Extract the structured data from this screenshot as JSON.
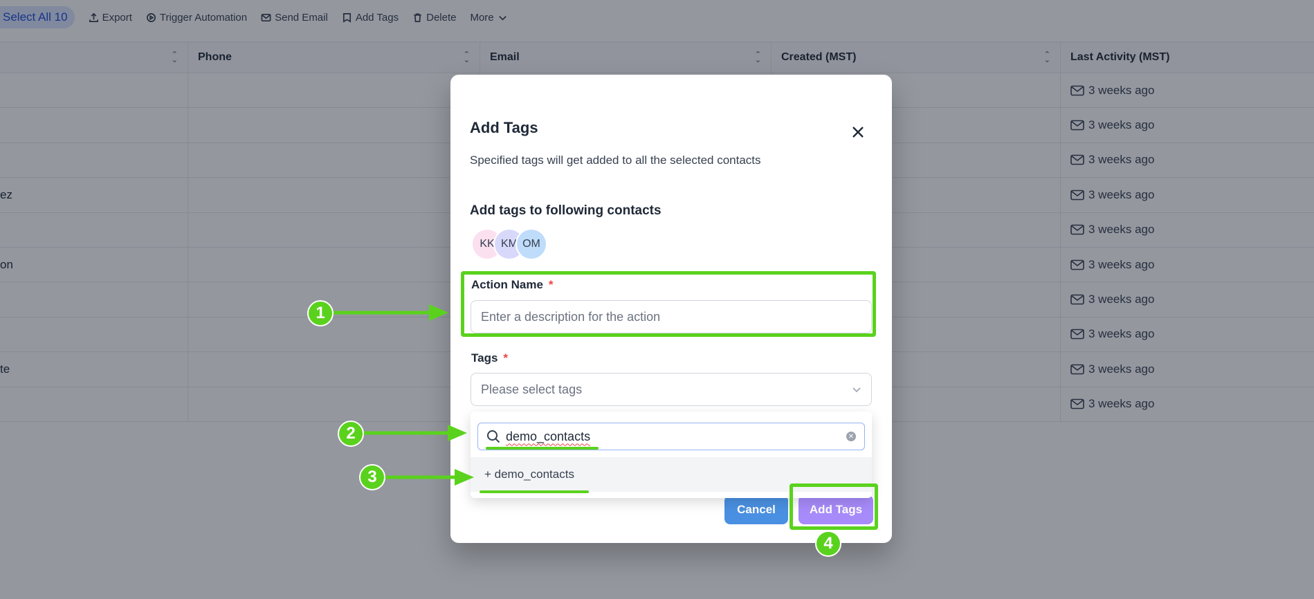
{
  "toolbar": {
    "select_all": "Select All 10",
    "items": [
      {
        "label": "Export",
        "icon": "upload-icon"
      },
      {
        "label": "Trigger Automation",
        "icon": "automation-icon"
      },
      {
        "label": "Send Email",
        "icon": "mail-icon"
      },
      {
        "label": "Add Tags",
        "icon": "tag-icon"
      },
      {
        "label": "Delete",
        "icon": "trash-icon"
      },
      {
        "label": "More",
        "icon": "chevron-down-icon"
      }
    ]
  },
  "table": {
    "headers": [
      "",
      "Phone",
      "Email",
      "Created (MST)",
      "Last Activity (MST)"
    ],
    "rows": [
      {
        "name_fragment": "",
        "last_activity": "3 weeks ago"
      },
      {
        "name_fragment": "",
        "last_activity": "3 weeks ago"
      },
      {
        "name_fragment": "",
        "last_activity": "3 weeks ago"
      },
      {
        "name_fragment": "ez",
        "last_activity": "3 weeks ago"
      },
      {
        "name_fragment": "",
        "last_activity": "3 weeks ago"
      },
      {
        "name_fragment": "on",
        "last_activity": "3 weeks ago"
      },
      {
        "name_fragment": "",
        "last_activity": "3 weeks ago"
      },
      {
        "name_fragment": "",
        "last_activity": "3 weeks ago"
      },
      {
        "name_fragment": "te",
        "last_activity": "3 weeks ago"
      },
      {
        "name_fragment": "",
        "last_activity": "3 weeks ago"
      }
    ]
  },
  "modal": {
    "title": "Add Tags",
    "description": "Specified tags will get added to all the selected contacts",
    "contacts_title": "Add tags to following contacts",
    "avatars": [
      "KK",
      "KM",
      "OM"
    ],
    "action_name_label": "Action Name",
    "required_mark": "*",
    "action_name_placeholder": "Enter a description for the action",
    "tags_label": "Tags",
    "tags_placeholder": "Please select tags",
    "search_value": "demo_contacts",
    "option_label": "+ demo_contacts",
    "cancel_label": "Cancel",
    "submit_label": "Add Tags"
  },
  "annotations": {
    "badges": [
      "1",
      "2",
      "3",
      "4"
    ],
    "color": "#5ad21d"
  },
  "colors": {
    "primary_blue": "#4a90e2",
    "add_tags_purple": "#a78bfa",
    "required_red": "#ef4444"
  }
}
